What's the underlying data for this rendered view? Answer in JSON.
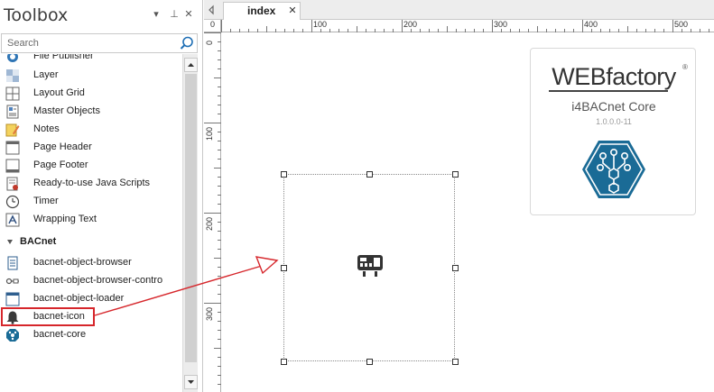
{
  "toolbox": {
    "title": "Toolbox",
    "controls": {
      "dropdown": "▾",
      "pin": "⊥",
      "close": "✕"
    },
    "search": {
      "placeholder": "Search",
      "value": ""
    },
    "items": [
      {
        "label": "File Publisher",
        "icon": "file-publisher-icon"
      },
      {
        "label": "Layer",
        "icon": "layer-icon"
      },
      {
        "label": "Layout Grid",
        "icon": "layout-grid-icon"
      },
      {
        "label": "Master Objects",
        "icon": "master-objects-icon"
      },
      {
        "label": "Notes",
        "icon": "notes-icon"
      },
      {
        "label": "Page Header",
        "icon": "page-header-icon"
      },
      {
        "label": "Page Footer",
        "icon": "page-footer-icon"
      },
      {
        "label": "Ready-to-use Java Scripts",
        "icon": "script-icon"
      },
      {
        "label": "Timer",
        "icon": "timer-icon"
      },
      {
        "label": "Wrapping Text",
        "icon": "wrapping-text-icon"
      }
    ],
    "group": {
      "label": "BACnet"
    },
    "bacnet_items": [
      {
        "label": "bacnet-object-browser",
        "icon": "object-browser-icon"
      },
      {
        "label": "bacnet-object-browser-contro",
        "icon": "object-browser-control-icon"
      },
      {
        "label": "bacnet-object-loader",
        "icon": "object-loader-icon"
      },
      {
        "label": "bacnet-icon",
        "icon": "bell-icon"
      },
      {
        "label": "bacnet-core",
        "icon": "bacnet-core-icon"
      }
    ]
  },
  "document": {
    "tab_label": "index",
    "close": "✕"
  },
  "ruler": {
    "h_labels": [
      "0",
      "100",
      "200",
      "300",
      "400",
      "500"
    ],
    "v_labels": [
      "0",
      "100",
      "200",
      "300"
    ]
  },
  "card": {
    "brand": "WEBfactory",
    "registered": "®",
    "title": "i4BACnet Core",
    "version": "1.0.0.0-11"
  },
  "colors": {
    "highlight": "#d6262b",
    "bacnet_blue": "#1a6b96"
  }
}
